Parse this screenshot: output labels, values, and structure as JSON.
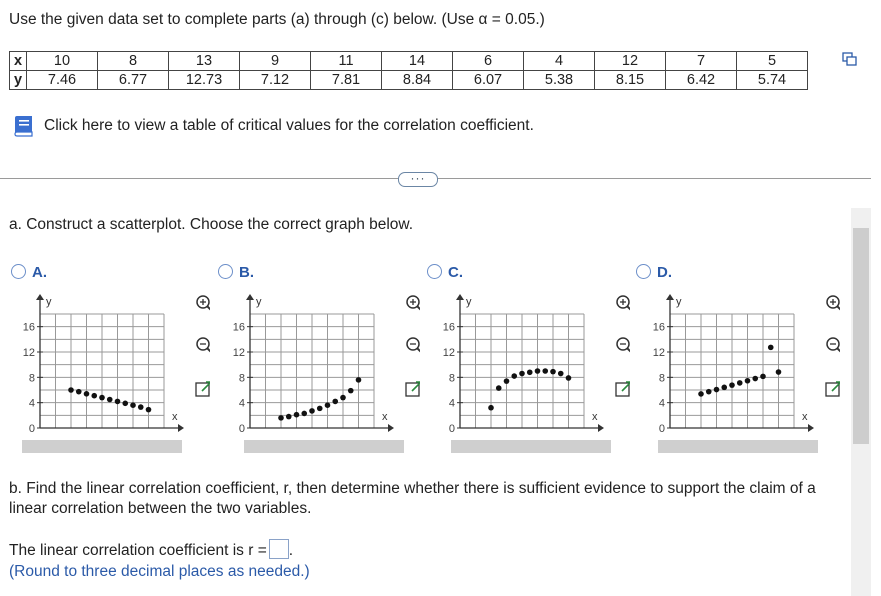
{
  "intro": "Use the given data set to complete parts (a) through (c) below. (Use α = 0.05.)",
  "table": {
    "x_label": "x",
    "y_label": "y",
    "x": [
      "10",
      "8",
      "13",
      "9",
      "11",
      "14",
      "6",
      "4",
      "12",
      "7",
      "5"
    ],
    "y": [
      "7.46",
      "6.77",
      "12.73",
      "7.12",
      "7.81",
      "8.84",
      "6.07",
      "5.38",
      "8.15",
      "6.42",
      "5.74"
    ]
  },
  "crit_link": "Click here to view a table of critical values for the correlation coefficient.",
  "more_label": "···",
  "part_a": "a. Construct a scatterplot. Choose the correct graph below.",
  "options": [
    {
      "label": "A.",
      "tick_y": [
        "16",
        "12",
        "8",
        "4",
        "0"
      ],
      "axis_x": "x",
      "axis_y": "y",
      "points": [
        [
          4,
          6.0
        ],
        [
          5,
          5.74
        ],
        [
          6,
          5.4
        ],
        [
          7,
          5.1
        ],
        [
          8,
          4.8
        ],
        [
          9,
          4.5
        ],
        [
          10,
          4.2
        ],
        [
          11,
          3.9
        ],
        [
          12,
          3.6
        ],
        [
          13,
          3.3
        ],
        [
          14,
          2.9
        ]
      ]
    },
    {
      "label": "B.",
      "tick_y": [
        "16",
        "12",
        "8",
        "4",
        "0"
      ],
      "axis_x": "x",
      "axis_y": "y",
      "points": [
        [
          4,
          1.6
        ],
        [
          5,
          1.8
        ],
        [
          6,
          2.1
        ],
        [
          7,
          2.3
        ],
        [
          8,
          2.7
        ],
        [
          9,
          3.1
        ],
        [
          10,
          3.6
        ],
        [
          11,
          4.2
        ],
        [
          12,
          4.8
        ],
        [
          13,
          5.9
        ],
        [
          14,
          7.6
        ]
      ]
    },
    {
      "label": "C.",
      "tick_y": [
        "16",
        "12",
        "8",
        "4",
        "0"
      ],
      "axis_x": "x",
      "axis_y": "y",
      "points": [
        [
          4,
          3.2
        ],
        [
          5,
          6.3
        ],
        [
          6,
          7.4
        ],
        [
          7,
          8.2
        ],
        [
          8,
          8.6
        ],
        [
          9,
          8.8
        ],
        [
          10,
          9.0
        ],
        [
          11,
          9.0
        ],
        [
          12,
          8.9
        ],
        [
          13,
          8.6
        ],
        [
          14,
          7.9
        ]
      ]
    },
    {
      "label": "D.",
      "tick_y": [
        "16",
        "12",
        "8",
        "4",
        "0"
      ],
      "axis_x": "x",
      "axis_y": "y",
      "points": [
        [
          4,
          5.38
        ],
        [
          5,
          5.74
        ],
        [
          6,
          6.07
        ],
        [
          7,
          6.42
        ],
        [
          8,
          6.77
        ],
        [
          9,
          7.12
        ],
        [
          10,
          7.46
        ],
        [
          11,
          7.81
        ],
        [
          12,
          8.15
        ],
        [
          13,
          12.73
        ],
        [
          14,
          8.84
        ]
      ]
    }
  ],
  "part_b": "b. Find the linear correlation coefficient, r, then determine whether there is sufficient evidence to support the claim of a linear correlation between the two variables.",
  "r_prefix": "The linear correlation coefficient is r =",
  "r_suffix": ".",
  "round_note": "(Round to three decimal places as needed.)",
  "colors": {
    "accent": "#2b5aa8",
    "grid": "#999999",
    "point": "#111111"
  }
}
